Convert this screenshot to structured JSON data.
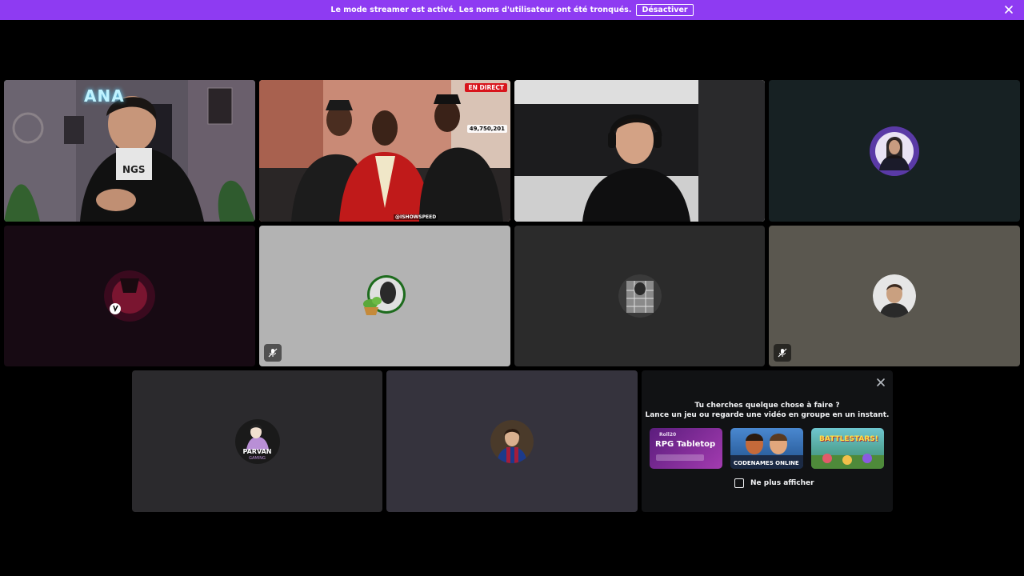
{
  "banner": {
    "message": "Le mode streamer est activé. Les noms d'utilisateur ont été tronqués.",
    "disable_label": "Désactiver"
  },
  "tiles": {
    "stream_live_badge": "EN DIRECT",
    "stream_viewer_count": "49,750,201",
    "stream_watermark": "@ISHOWSPEED",
    "neon_sign": "ANA"
  },
  "activity_panel": {
    "line1": "Tu cherches quelque chose à faire ?",
    "line2": "Lance un jeu ou regarde une vidéo en groupe en un instant.",
    "games": [
      {
        "name": "RPG Tabletop",
        "brand": "Roll20",
        "color": "#7a2e9a"
      },
      {
        "name": "CODENAMES ONLINE",
        "color": "#2a6fb0"
      },
      {
        "name": "BATTLESTARS!",
        "color": "#4aa3a8"
      }
    ],
    "dont_show_label": "Ne plus afficher"
  },
  "avatar_texts": {
    "parvan": "PARVAN",
    "parvan_sub": "GAMING"
  },
  "colors": {
    "banner": "#8e3bf2",
    "speaking_outline": "#3ba55c",
    "panel_bg": "#111214"
  }
}
